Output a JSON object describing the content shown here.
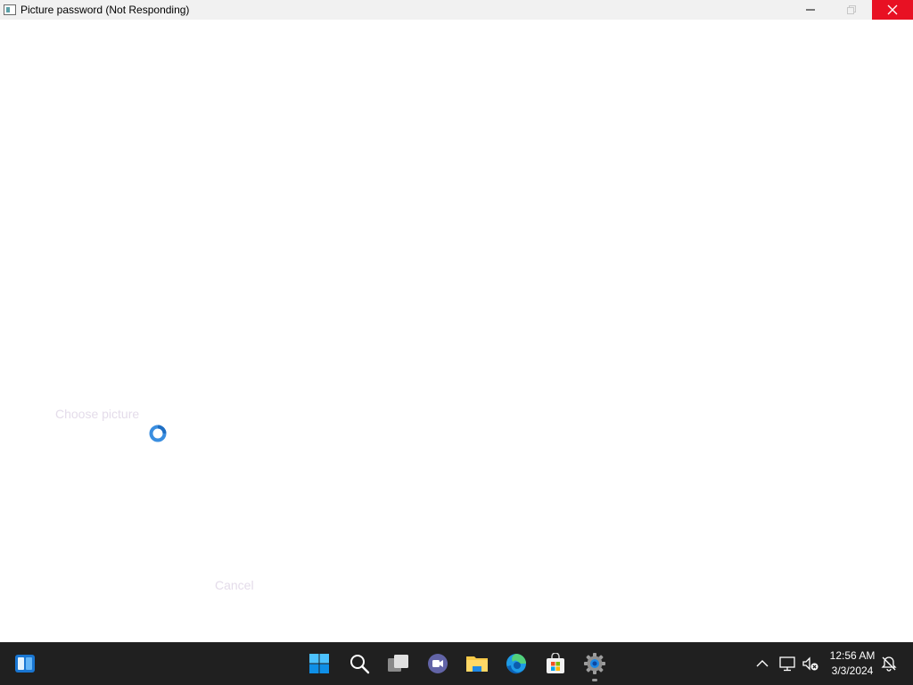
{
  "window": {
    "title": "Picture password (Not Responding)"
  },
  "content": {
    "choose_picture_label": "Choose picture",
    "cancel_label": "Cancel"
  },
  "taskbar": {
    "widgets_icon": "widgets-icon",
    "pinned": [
      {
        "name": "start",
        "icon": "windows-logo-icon"
      },
      {
        "name": "search",
        "icon": "search-icon"
      },
      {
        "name": "task-view",
        "icon": "task-view-icon"
      },
      {
        "name": "teams-chat",
        "icon": "teams-chat-icon"
      },
      {
        "name": "file-explorer",
        "icon": "folder-icon"
      },
      {
        "name": "edge",
        "icon": "edge-icon"
      },
      {
        "name": "microsoft-store",
        "icon": "store-icon"
      },
      {
        "name": "settings",
        "icon": "gear-icon",
        "active": true
      }
    ],
    "tray": {
      "time": "12:56 AM",
      "date": "3/3/2024"
    }
  },
  "colors": {
    "close_button": "#e81123",
    "taskbar_bg": "#202020",
    "faded_text": "#e4dcea",
    "accent": "#0078d4"
  }
}
